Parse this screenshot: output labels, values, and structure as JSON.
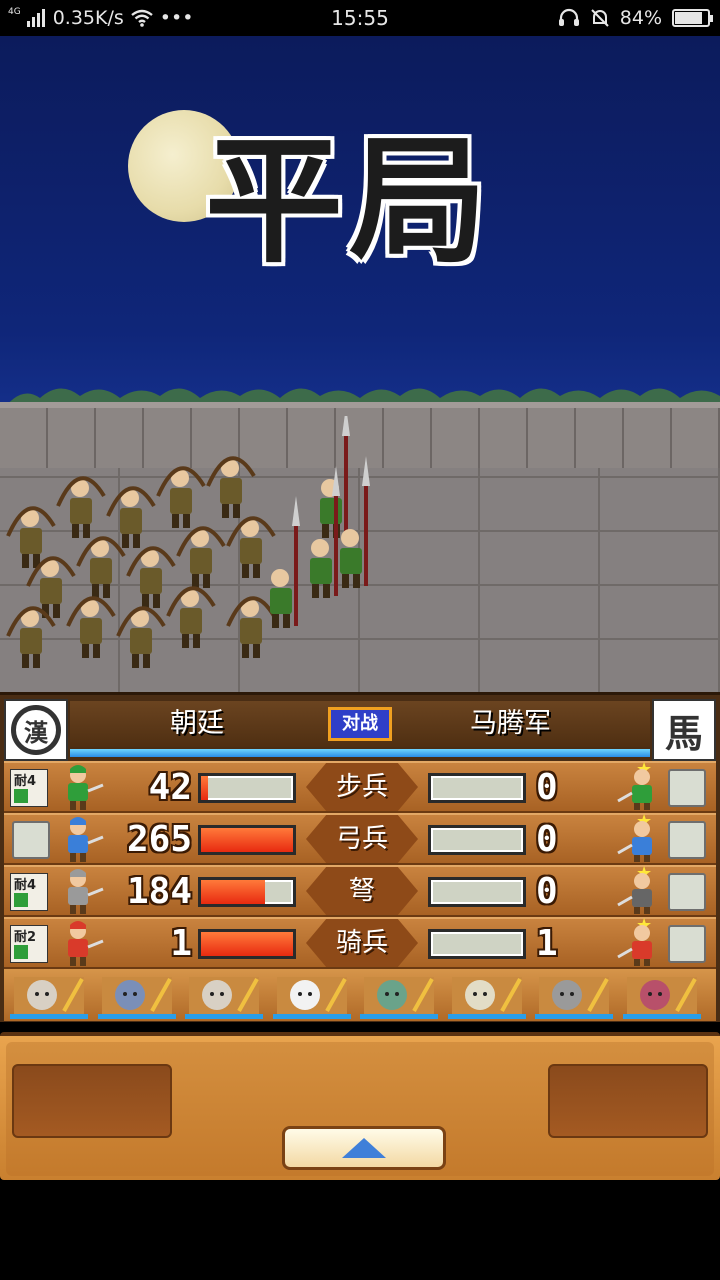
{
  "status_bar": {
    "network_type": "4G",
    "speed": "0.35K/s",
    "more": "•••",
    "time": "15:55",
    "battery": "84%",
    "battery_level": 0.84,
    "icons": [
      "signal-icon",
      "wifi-icon",
      "headset-icon",
      "mute-bell-icon",
      "battery-icon"
    ]
  },
  "scene": {
    "result_title": "平局"
  },
  "panel": {
    "left_army": "朝廷",
    "right_army": "马腾军",
    "vs_label": "对战",
    "right_emblem": "馬",
    "morale_fraction": 1.0,
    "rows": [
      {
        "type": "步兵",
        "left_count": "42",
        "right_count": "0",
        "left_fill": 0.08,
        "right_fill": 0.0,
        "left_tag": "耐4",
        "left_unit_color": "#2f9e3a",
        "right_unit_color": "#2f9e3a"
      },
      {
        "type": "弓兵",
        "left_count": "265",
        "right_count": "0",
        "left_fill": 1.0,
        "right_fill": 0.0,
        "left_tag": "",
        "left_unit_color": "#3a7fd9",
        "right_unit_color": "#3a7fd9"
      },
      {
        "type": "弩",
        "left_count": "184",
        "right_count": "0",
        "left_fill": 0.7,
        "right_fill": 0.0,
        "left_tag": "耐4",
        "left_unit_color": "#9a9a9a",
        "right_unit_color": "#666666"
      },
      {
        "type": "骑兵",
        "left_count": "1",
        "right_count": "1",
        "left_fill": 1.0,
        "right_fill": 0.0,
        "left_tag": "耐2",
        "left_unit_color": "#d93a2a",
        "right_unit_color": "#d93a2a"
      }
    ]
  },
  "colors": {
    "hp_bar": "#e82a10",
    "morale_bar": "#2a8ee8",
    "button_arrow": "#3f7fd9"
  }
}
